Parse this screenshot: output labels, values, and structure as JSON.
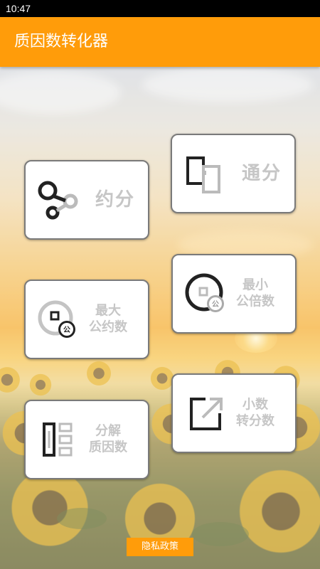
{
  "status_bar": {
    "time": "10:47"
  },
  "app_bar": {
    "title": "质因数转化器"
  },
  "colors": {
    "accent": "#ff9c0a",
    "card_label": "#c6c6c6",
    "card_border": "#7a7a7a"
  },
  "cards": [
    {
      "id": "reduce",
      "label": "约分",
      "icon": "share-nodes-icon"
    },
    {
      "id": "common-denominator",
      "label": "通分",
      "icon": "split-panels-icon"
    },
    {
      "id": "gcd",
      "label_line1": "最大",
      "label_line2": "公约数",
      "icon": "gcd-badge-icon",
      "badge": "公"
    },
    {
      "id": "lcm",
      "label_line1": "最小",
      "label_line2": "公倍数",
      "icon": "lcm-ring-icon",
      "badge": "公"
    },
    {
      "id": "factorize",
      "label_line1": "分解",
      "label_line2": "质因数",
      "icon": "list-blocks-icon"
    },
    {
      "id": "decimal-to-fraction",
      "label_line1": "小数",
      "label_line2": "转分数",
      "icon": "external-arrow-icon"
    }
  ],
  "footer": {
    "privacy_label": "隐私政策"
  }
}
